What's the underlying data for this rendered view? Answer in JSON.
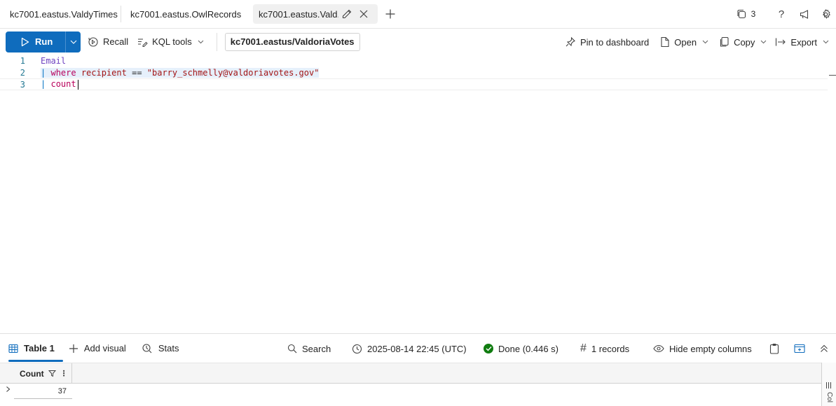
{
  "tabs": [
    {
      "label": "kc7001.eastus.ValdyTimes"
    },
    {
      "label": "kc7001.eastus.OwlRecords"
    },
    {
      "label": "kc7001.eastus.Vald..."
    }
  ],
  "tabbar": {
    "query_count": "3",
    "help": "?"
  },
  "toolbar": {
    "run": "Run",
    "recall": "Recall",
    "kql_tools": "KQL tools",
    "database": "kc7001.eastus/ValdoriaVotes",
    "pin": "Pin to dashboard",
    "open": "Open",
    "copy": "Copy",
    "export": "Export"
  },
  "editor": {
    "line_numbers": [
      "1",
      "2",
      "3"
    ],
    "line1_table": "Email",
    "line2_pipe": "|",
    "line2_kw": "where",
    "line2_field": "recipient",
    "line2_op": "==",
    "line2_str": "\"barry_schmelly@valdoriavotes.gov\"",
    "line3_pipe": "|",
    "line3_kw": "count"
  },
  "results": {
    "table_tab": "Table 1",
    "add_visual": "Add visual",
    "stats": "Stats",
    "search": "Search",
    "timestamp": "2025-08-14 22:45 (UTC)",
    "status": "Done (0.446 s)",
    "records": "1 records",
    "hide_empty": "Hide empty columns"
  },
  "grid": {
    "column": "Count",
    "value": "37",
    "side_label": "Col"
  },
  "colors": {
    "accent": "#0f6cbd",
    "success": "#107c10"
  }
}
